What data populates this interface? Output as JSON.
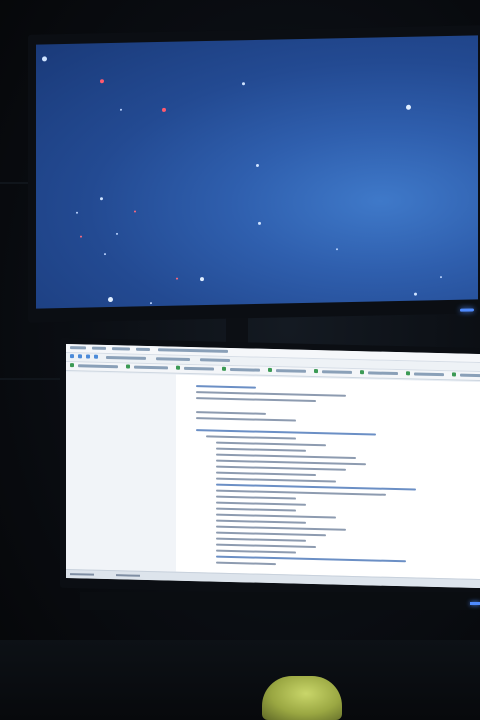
{
  "scene": {
    "description_colors": {
      "top_screen_blue": "#2f5fae",
      "bottom_screen_white": "#e9eef4",
      "led_blue": "#4f8bff",
      "object_yellow": "#c9d66a"
    }
  }
}
